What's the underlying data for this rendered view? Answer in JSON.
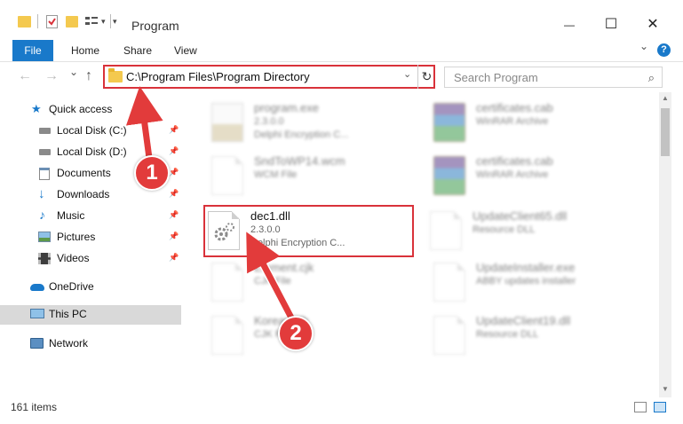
{
  "window": {
    "title": "Program",
    "minimize_glyph": "—",
    "maximize_glyph": "☐",
    "close_glyph": "✕"
  },
  "ribbon": {
    "file": "File",
    "tabs": [
      "Home",
      "Share",
      "View"
    ],
    "expand_glyph": "⌄",
    "help_glyph": "?"
  },
  "nav_buttons": {
    "back": "←",
    "forward": "→",
    "recent": "⌄",
    "up": "↑"
  },
  "address": {
    "path": "C:\\Program Files\\Program Directory",
    "dropdown_glyph": "⌄",
    "refresh_glyph": "↻"
  },
  "search": {
    "placeholder": "Search Program",
    "icon_glyph": "⌕"
  },
  "nav_pane": {
    "items": [
      {
        "label": "Quick access",
        "icon": "star-icon",
        "pinned": false
      },
      {
        "label": "Local Disk (C:)",
        "icon": "drive-icon",
        "pinned": true
      },
      {
        "label": "Local Disk (D:)",
        "icon": "drive-icon",
        "pinned": true
      },
      {
        "label": "Documents",
        "icon": "documents-icon",
        "pinned": true
      },
      {
        "label": "Downloads",
        "icon": "downloads-icon",
        "pinned": true
      },
      {
        "label": "Music",
        "icon": "music-icon",
        "pinned": true
      },
      {
        "label": "Pictures",
        "icon": "pictures-icon",
        "pinned": true
      },
      {
        "label": "Videos",
        "icon": "videos-icon",
        "pinned": true
      },
      {
        "label": "OneDrive",
        "icon": "cloud-icon",
        "pinned": false
      },
      {
        "label": "This PC",
        "icon": "computer-icon",
        "pinned": false,
        "selected": true
      },
      {
        "label": "Network",
        "icon": "network-icon",
        "pinned": false
      }
    ],
    "pin_glyph": "📌"
  },
  "files": [
    {
      "name": "program.exe",
      "line2": "2.3.0.0",
      "line3": "Delphi Encryption C...",
      "icon": "exe-icon",
      "blurred": true
    },
    {
      "name": "certificates.cab",
      "line2": "WinRAR Archive",
      "line3": "",
      "icon": "archive-icon",
      "blurred": true
    },
    {
      "name": "SndToWP14.wcm",
      "line2": "WCM File",
      "line3": "",
      "icon": "file-icon",
      "blurred": true
    },
    {
      "name": "certificates.cab",
      "line2": "WinRAR Archive",
      "line3": "",
      "icon": "archive-icon",
      "blurred": true
    },
    {
      "name": "dec1.dll",
      "line2": "2.3.0.0",
      "line3": "Delphi Encryption C...",
      "icon": "dll-gear-icon",
      "blurred": false
    },
    {
      "name": "UpdateClient65.dll",
      "line2": "Resource DLL",
      "line3": "",
      "icon": "dll-icon",
      "blurred": true
    },
    {
      "name": "Element.cjk",
      "line2": "CJK File",
      "line3": "",
      "icon": "file-icon",
      "blurred": true
    },
    {
      "name": "UpdateInstaller.exe",
      "line2": "ABBY updates installer",
      "line3": "",
      "icon": "file-icon",
      "blurred": true
    },
    {
      "name": "Korean.cjk",
      "line2": "CJK File",
      "line3": "",
      "icon": "file-icon",
      "blurred": true
    },
    {
      "name": "UpdateClient19.dll",
      "line2": "Resource DLL",
      "line3": "",
      "icon": "dll-icon",
      "blurred": true
    }
  ],
  "status": {
    "item_count": "161 items"
  },
  "annotations": {
    "callout_1": "1",
    "callout_2": "2",
    "color": "#e23b3b"
  },
  "colors": {
    "accent": "#1979ca",
    "highlight_border": "#d9323a",
    "selected_nav": "#d9d9d9"
  }
}
